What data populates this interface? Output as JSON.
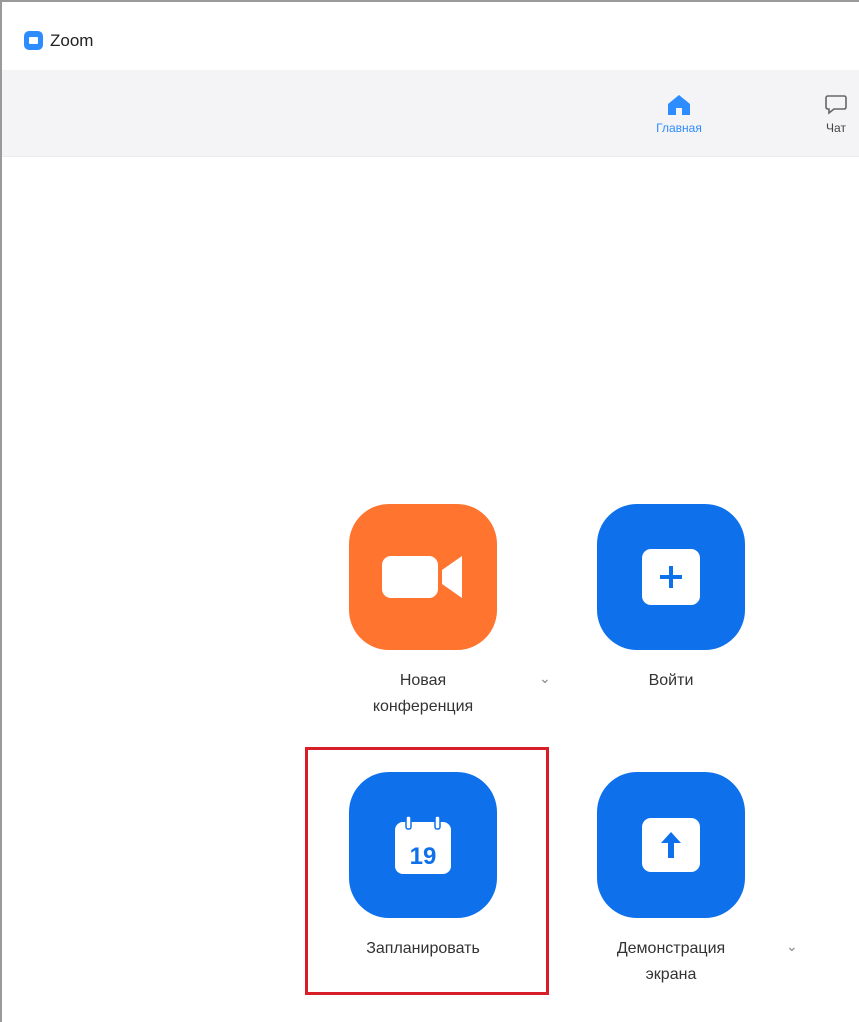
{
  "window": {
    "app_title": "Zoom",
    "app_icon": "zoom-logo-icon"
  },
  "tabs": [
    {
      "label": "Главная",
      "icon": "home-icon",
      "active": true
    },
    {
      "label": "Чат",
      "icon": "chat-icon",
      "active": false
    }
  ],
  "actions": {
    "new_meeting": {
      "line1": "Новая",
      "line2": "конференция",
      "icon": "video-camera-icon",
      "color": "#ff742e"
    },
    "join": {
      "label": "Войти",
      "icon": "plus-icon",
      "color": "#0e71eb"
    },
    "schedule": {
      "label": "Запланировать",
      "icon": "calendar-icon",
      "day": "19",
      "color": "#0e71eb"
    },
    "share_screen": {
      "line1": "Демонстрация",
      "line2": "экрана",
      "icon": "share-screen-arrow-icon",
      "color": "#0e71eb"
    }
  },
  "dropdown_glyph": "⌄",
  "highlight": {
    "color": "#d81e28",
    "target": "schedule"
  }
}
